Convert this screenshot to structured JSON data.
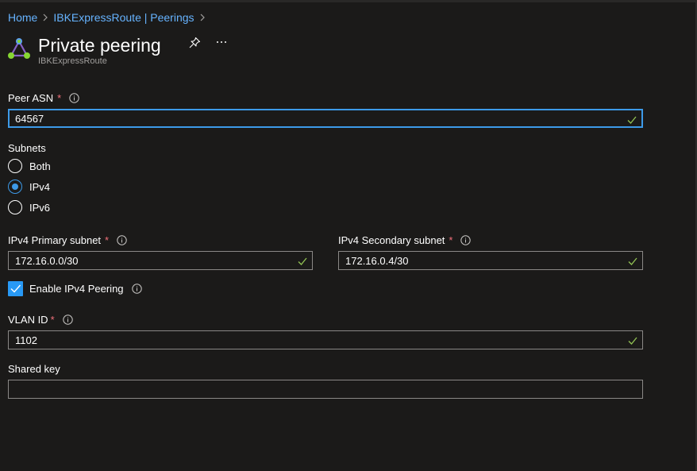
{
  "breadcrumb": [
    {
      "label": "Home"
    },
    {
      "label": "IBKExpressRoute | Peerings"
    }
  ],
  "header": {
    "title": "Private peering",
    "subtitle": "IBKExpressRoute",
    "icon": "expressroute-triangle-icon"
  },
  "form": {
    "peer_asn": {
      "label": "Peer ASN",
      "required": "*",
      "value": "64567"
    },
    "subnets": {
      "label": "Subnets",
      "options": [
        {
          "label": "Both",
          "selected": false
        },
        {
          "label": "IPv4",
          "selected": true
        },
        {
          "label": "IPv6",
          "selected": false
        }
      ]
    },
    "ipv4_primary": {
      "label": "IPv4 Primary subnet",
      "required": "*",
      "value": "172.16.0.0/30"
    },
    "ipv4_secondary": {
      "label": "IPv4 Secondary subnet",
      "required": "*",
      "value": "172.16.0.4/30"
    },
    "enable_ipv4_peering": {
      "label": "Enable IPv4 Peering",
      "checked": true
    },
    "vlan_id": {
      "label": "VLAN ID",
      "required": "*",
      "value": "1102"
    },
    "shared_key": {
      "label": "Shared key",
      "value": ""
    }
  },
  "colors": {
    "background": "#1b1a19",
    "link": "#66b3ff",
    "accent": "#3d9ae8",
    "required": "#f1707b",
    "valid_check": "#92c353"
  }
}
